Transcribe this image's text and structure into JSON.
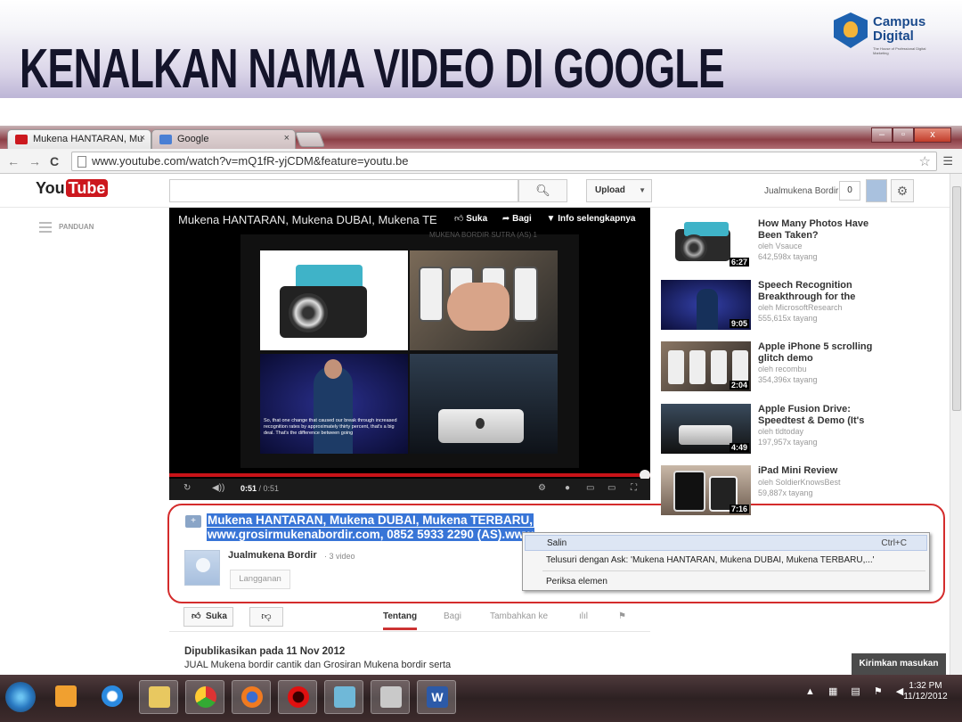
{
  "slide": {
    "title": "KENALKAN NAMA VIDEO DI GOOGLE",
    "logo_line1": "Campus",
    "logo_line2": "Digital",
    "logo_tagline": "The House of Professional Digital Marketing"
  },
  "browser": {
    "tabs": [
      {
        "label": "Mukena HANTARAN, Mu",
        "close": "×"
      },
      {
        "label": "Google",
        "close": "×"
      }
    ],
    "window_buttons": [
      "–",
      "▫",
      "x"
    ],
    "url": "www.youtube.com/watch?v=mQ1fR-yjCDM&feature=youtu.be"
  },
  "youtube": {
    "logo_you": "You",
    "logo_tube": "Tube",
    "search_placeholder": "",
    "search_icon": "search-icon",
    "upload_label": "Upload",
    "username": "Jualmukena Bordir",
    "notification_count": "0",
    "guide_label": "PANDUAN",
    "player": {
      "title": "Mukena HANTARAN, Mukena DUBAI, Mukena TE",
      "like": "Suka",
      "share": "Bagi",
      "info": "Info selengkapnya",
      "frame_caption": "MUKENA BORDIR SUTRA (AS) 1",
      "subtitle_text": "So, that one change that caused our break through increased recognition rates by approximately thirty percent, that's a big deal. That's the difference between going",
      "time_current": "0:51",
      "time_total": "/ 0:51",
      "progress_fraction": 1.0
    },
    "video": {
      "title_line1": "Mukena HANTARAN, Mukena DUBAI, Mukena TERBARU,",
      "title_line2": "www.grosirmukenabordir.com, 0852 5933 2290 (AS).www",
      "channel": "Jualmukena Bordir",
      "channel_videos": "· 3 video",
      "subscribe": "Langganan"
    },
    "context_menu": [
      {
        "label": "Salin",
        "shortcut": "Ctrl+C"
      },
      {
        "label": "Telusuri dengan Ask: 'Mukena HANTARAN, Mukena DUBAI, Mukena TERBARU,...'",
        "shortcut": ""
      },
      {
        "label": "Periksa elemen",
        "shortcut": ""
      }
    ],
    "actions": {
      "like": "Suka",
      "tabs": [
        "Tentang",
        "Bagi",
        "Tambahkan ke"
      ]
    },
    "published": "Dipublikasikan pada 11 Nov 2012",
    "description": "JUAL Mukena bordir cantik dan Grosiran Mukena bordir serta",
    "related": [
      {
        "title": "How Many Photos Have Been Taken?",
        "by": "oleh Vsauce",
        "views": "642,598x tayang",
        "duration": "6:27"
      },
      {
        "title": "Speech Recognition Breakthrough for the",
        "by": "oleh MicrosoftResearch",
        "views": "555,615x tayang",
        "duration": "9:05"
      },
      {
        "title": "Apple iPhone 5 scrolling glitch demo",
        "by": "oleh recombu",
        "views": "354,396x tayang",
        "duration": "2:04"
      },
      {
        "title": "Apple Fusion Drive: Speedtest & Demo (It's",
        "by": "oleh tldtoday",
        "views": "197,957x tayang",
        "duration": "4:49"
      },
      {
        "title": "iPad Mini Review",
        "by": "oleh SoldierKnowsBest",
        "views": "59,887x tayang",
        "duration": "7:16"
      }
    ],
    "feedback": "Kirimkan masukan"
  },
  "taskbar": {
    "time": "1:32 PM",
    "date": "11/12/2012",
    "apps": [
      "media-player",
      "internet-explorer",
      "explorer",
      "chrome",
      "firefox",
      "opera",
      "notepad",
      "paint",
      "word"
    ]
  },
  "colors": {
    "youtube_red": "#cc181e",
    "selection": "#3875d7",
    "annotation_ring": "#d42c2c"
  }
}
